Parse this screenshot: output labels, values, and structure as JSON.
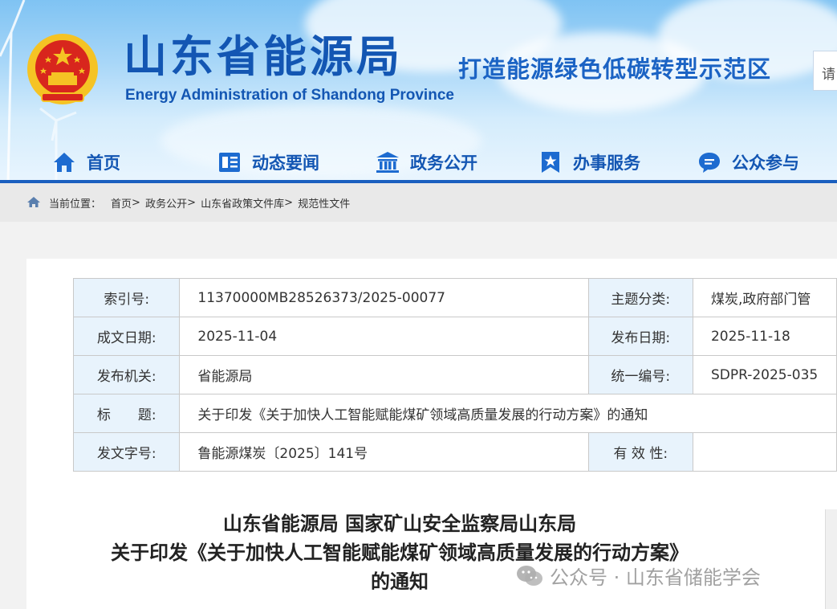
{
  "header": {
    "title_cn": "山东省能源局",
    "title_en": "Energy Administration of Shandong Province",
    "slogan": "打造能源绿色低碳转型示范区",
    "search_placeholder": "请"
  },
  "nav": {
    "items": [
      {
        "label": "首页",
        "icon": "home-icon"
      },
      {
        "label": "动态要闻",
        "icon": "news-icon"
      },
      {
        "label": "政务公开",
        "icon": "government-building-icon"
      },
      {
        "label": "办事服务",
        "icon": "bookmark-star-icon"
      },
      {
        "label": "公众参与",
        "icon": "chat-bubble-icon"
      }
    ]
  },
  "breadcrumb": {
    "prefix": "当前位置：",
    "items": [
      "首页",
      "政务公开",
      "山东省政策文件库",
      "规范性文件"
    ],
    "separator": ">"
  },
  "info": {
    "rows": [
      {
        "label1": "索引号:",
        "value1": "11370000MB28526373/2025-00077",
        "label2": "主题分类:",
        "value2": "煤炭,政府部门管"
      },
      {
        "label1": "成文日期:",
        "value1": "2025-11-04",
        "label2": "发布日期:",
        "value2": "2025-11-18"
      },
      {
        "label1": "发布机关:",
        "value1": "省能源局",
        "label2": "统一编号:",
        "value2": "SDPR-2025-035"
      },
      {
        "label1": "标　　题:",
        "value1": "关于印发《关于加快人工智能赋能煤矿领域高质量发展的行动方案》的通知"
      },
      {
        "label1": "发文字号:",
        "value1": "鲁能源煤炭〔2025〕141号",
        "label2": "有 效 性:",
        "value2": ""
      }
    ]
  },
  "document": {
    "title_line1": "山东省能源局 国家矿山安全监察局山东局",
    "title_line2": "关于印发《关于加快人工智能赋能煤矿领域高质量发展的行动方案》",
    "title_line3": "的通知"
  },
  "watermark": {
    "text": "公众号 · 山东省储能学会",
    "icon": "wechat-icon"
  },
  "colors": {
    "brand_blue": "#1356b3",
    "label_bg": "#e8f3fc",
    "emblem_red": "#d8261d",
    "emblem_gold": "#f5c324"
  }
}
